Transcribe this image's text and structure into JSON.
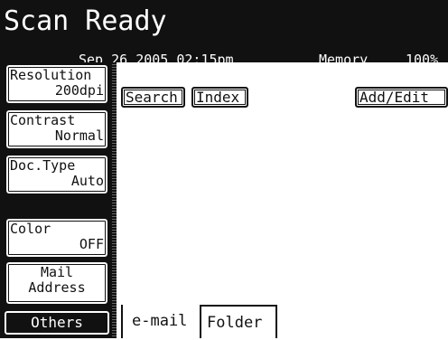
{
  "title": "Scan Ready",
  "status": {
    "date": "Sep 26 2005 02:15pm",
    "memory_label": "Memory",
    "memory_value": "100%"
  },
  "sidebar": [
    {
      "l1": "Resolution",
      "l2": "200dpi"
    },
    {
      "l1": "Contrast",
      "l2": "Normal"
    },
    {
      "l1": "Doc.Type",
      "l2": "Auto"
    },
    {
      "l1": "Color",
      "l2": "OFF"
    },
    {
      "l1": "Mail",
      "l2": "Address"
    },
    {
      "l1": "Others"
    }
  ],
  "toolbar": {
    "search": "Search",
    "index": "Index",
    "add_edit": "Add/Edit"
  },
  "tabs": {
    "email": "e-mail",
    "folder": "Folder"
  }
}
